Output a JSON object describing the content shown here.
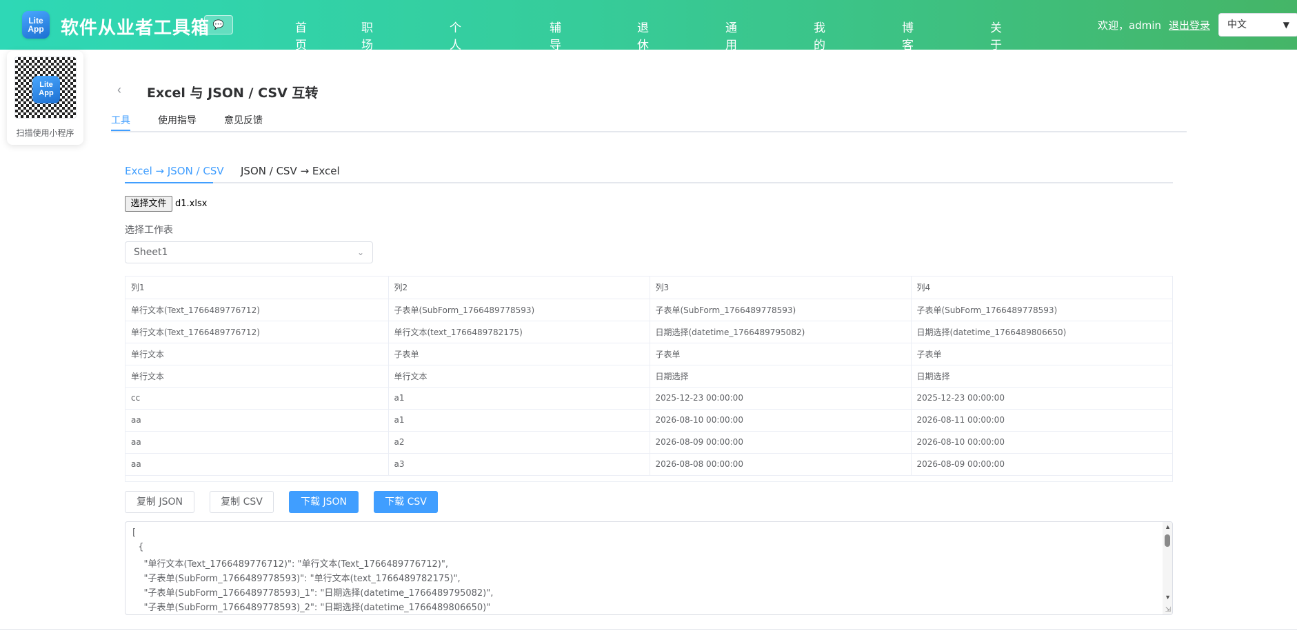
{
  "header": {
    "logo_line1": "Lite",
    "logo_line2": "App",
    "brand": "软件从业者工具箱",
    "nav": [
      "首页",
      "职场准备",
      "个人开发者",
      "辅导作业",
      "退休生活",
      "通用工具",
      "我的收藏",
      "博客文章",
      "关于我们"
    ],
    "welcome": "欢迎，admin",
    "logout": "退出登录",
    "language": "中文"
  },
  "qr": {
    "center_line1": "Lite",
    "center_line2": "App",
    "label": "扫描使用小程序"
  },
  "page": {
    "title": "Excel 与 JSON / CSV 互转",
    "tabs": [
      "工具",
      "使用指导",
      "意见反馈"
    ],
    "subtabs": [
      "Excel → JSON / CSV",
      "JSON / CSV → Excel"
    ],
    "file_button": "选择文件",
    "file_name": "d1.xlsx",
    "sheet_label": "选择工作表",
    "sheet_value": "Sheet1"
  },
  "table": {
    "rows": [
      [
        "列1",
        "列2",
        "列3",
        "列4"
      ],
      [
        "单行文本(Text_1766489776712)",
        "子表单(SubForm_1766489778593)",
        "子表单(SubForm_1766489778593)",
        "子表单(SubForm_1766489778593)"
      ],
      [
        "单行文本(Text_1766489776712)",
        "单行文本(text_1766489782175)",
        "日期选择(datetime_1766489795082)",
        "日期选择(datetime_1766489806650)"
      ],
      [
        "单行文本",
        "子表单",
        "子表单",
        "子表单"
      ],
      [
        "单行文本",
        "单行文本",
        "日期选择",
        "日期选择"
      ],
      [
        "cc",
        "a1",
        "2025-12-23 00:00:00",
        "2025-12-23 00:00:00"
      ],
      [
        "aa",
        "a1",
        "2026-08-10 00:00:00",
        "2026-08-11 00:00:00"
      ],
      [
        "aa",
        "a2",
        "2026-08-09 00:00:00",
        "2026-08-10 00:00:00"
      ],
      [
        "aa",
        "a3",
        "2026-08-08 00:00:00",
        "2026-08-09 00:00:00"
      ]
    ]
  },
  "actions": {
    "copy_json": "复制 JSON",
    "copy_csv": "复制 CSV",
    "download_json": "下载 JSON",
    "download_csv": "下载 CSV"
  },
  "output": {
    "lines": [
      "[",
      "  {",
      "    \"单行文本(Text_1766489776712)\": \"单行文本(Text_1766489776712)\",",
      "    \"子表单(SubForm_1766489778593)\": \"单行文本(text_1766489782175)\",",
      "    \"子表单(SubForm_1766489778593)_1\": \"日期选择(datetime_1766489795082)\",",
      "    \"子表单(SubForm_1766489778593)_2\": \"日期选择(datetime_1766489806650)\""
    ]
  },
  "colors": {
    "header_start": "#2ed8b6",
    "header_end": "#45b567",
    "accent": "#409eff"
  }
}
